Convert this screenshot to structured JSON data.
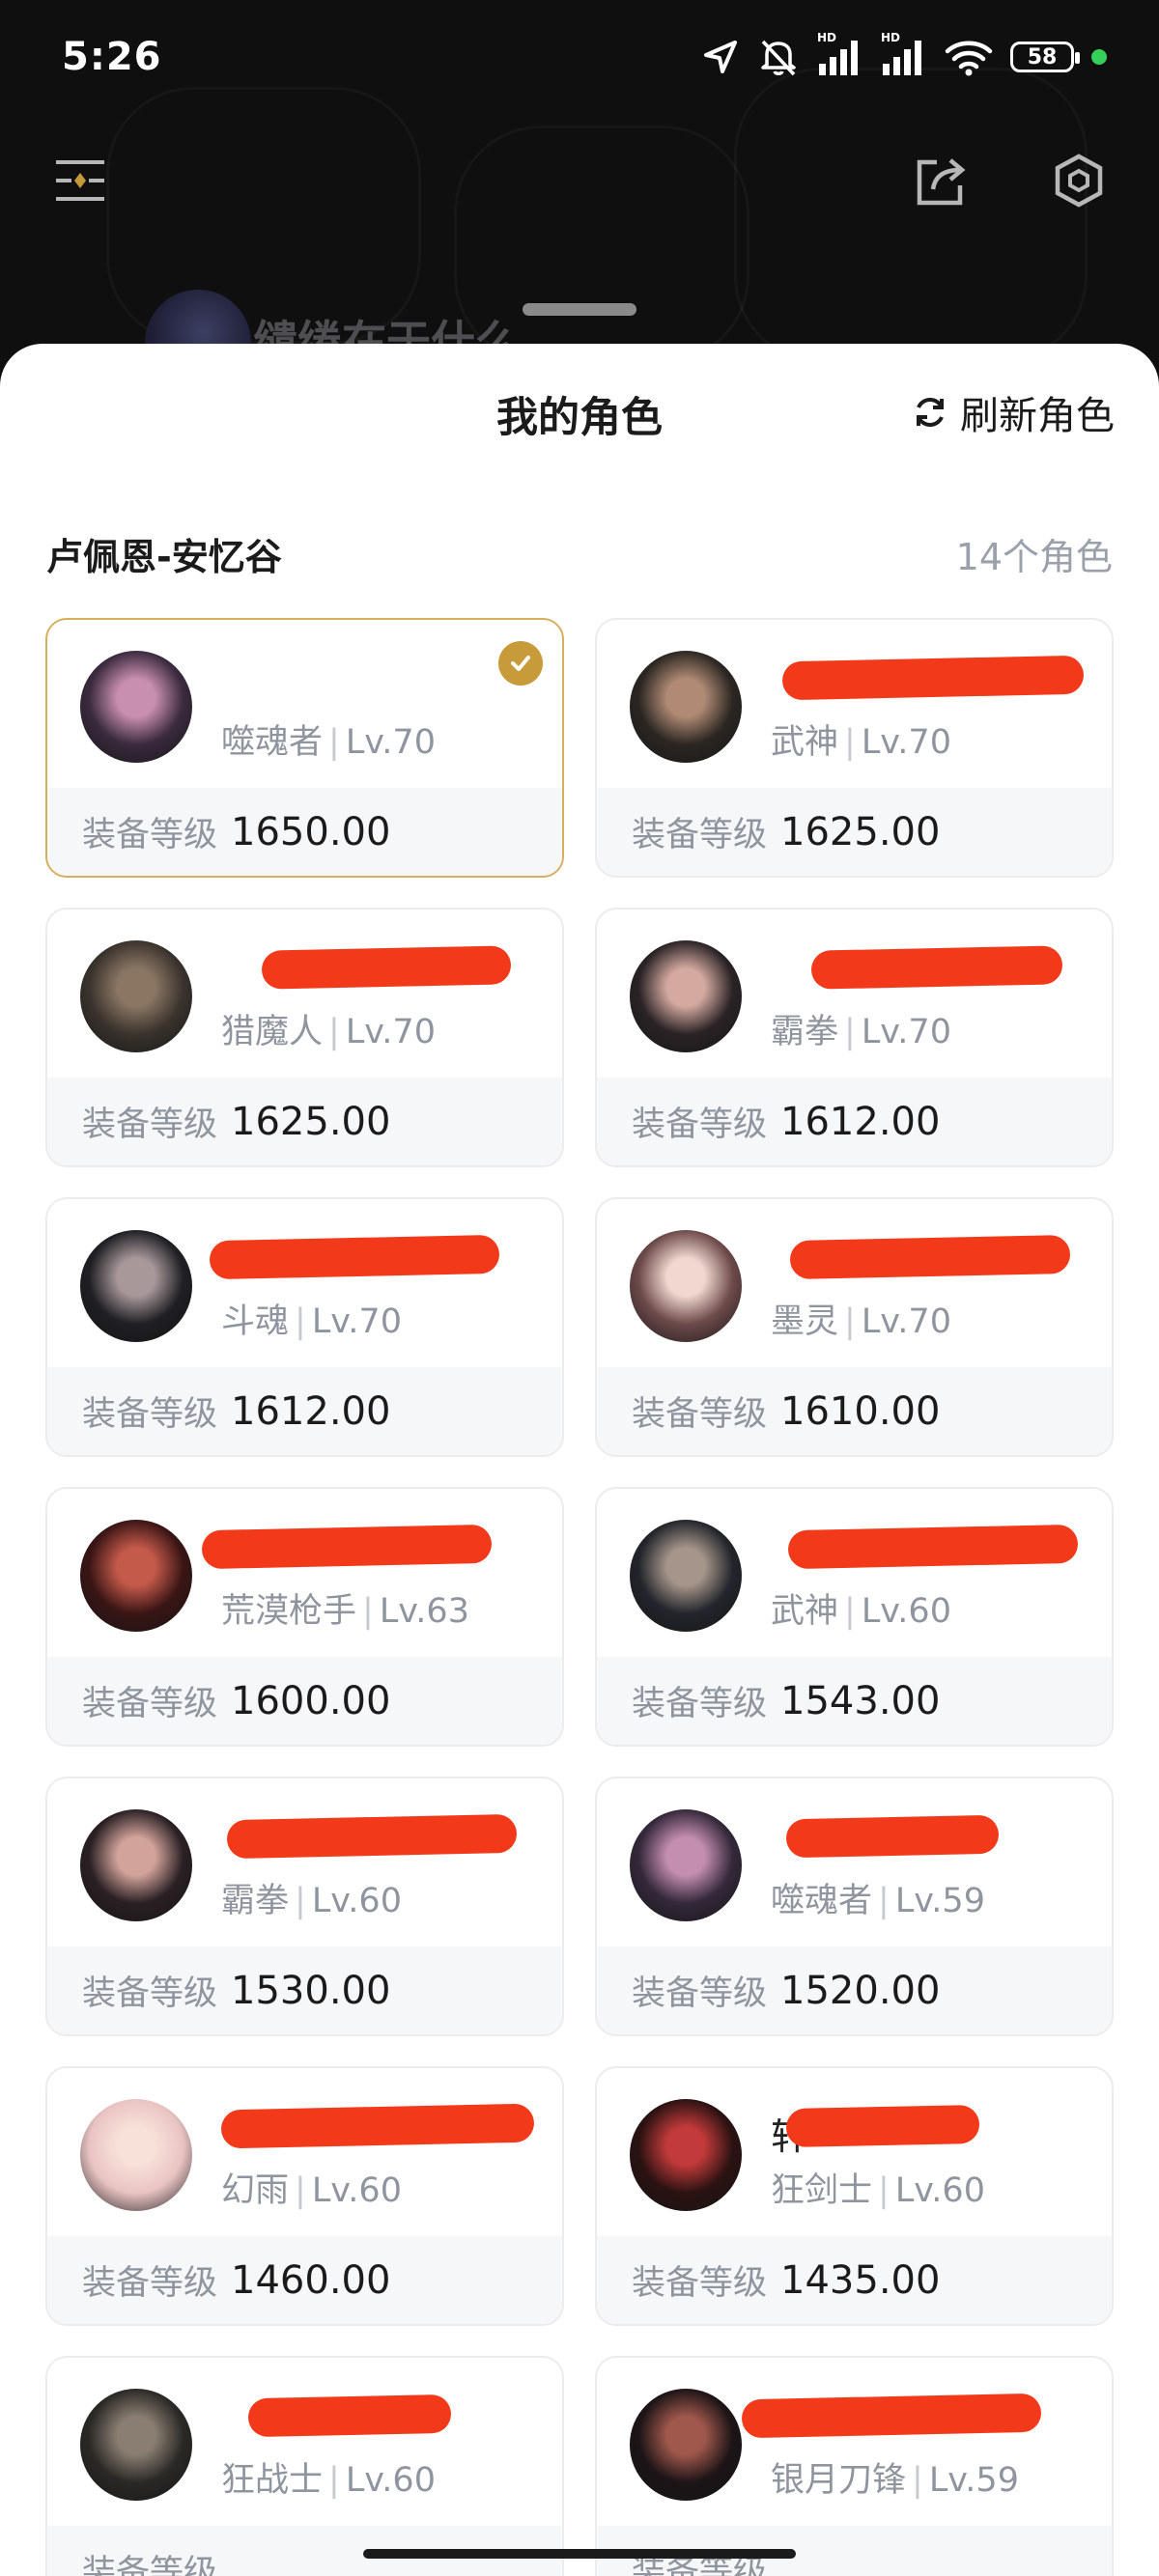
{
  "status_bar": {
    "time": "5:26",
    "hd1": "HD",
    "hd2": "HD",
    "battery": "58"
  },
  "background_app": {
    "profile_name": "缱绻在于什么"
  },
  "sheet": {
    "title": "我的角色",
    "refresh_label": "刷新角色",
    "server_name": "卢佩恩-安忆谷",
    "character_count": "14个角色",
    "gear_label": "装备等级"
  },
  "characters": [
    {
      "name": "",
      "class": "噬魂者",
      "level": "Lv.70",
      "gear": "1650.00",
      "selected": true,
      "avatar_bg": "#3a2a3e",
      "avatar_fg": "#c98fb0"
    },
    {
      "name": "",
      "class": "武神",
      "level": "Lv.70",
      "gear": "1625.00",
      "selected": false,
      "avatar_bg": "#2b2622",
      "avatar_fg": "#b08a74"
    },
    {
      "name": "",
      "class": "猎魔人",
      "level": "Lv.70",
      "gear": "1625.00",
      "selected": false,
      "avatar_bg": "#3a332d",
      "avatar_fg": "#8a7663"
    },
    {
      "name": "",
      "class": "霸拳",
      "level": "Lv.70",
      "gear": "1612.00",
      "selected": false,
      "avatar_bg": "#2a2325",
      "avatar_fg": "#d4a9a0"
    },
    {
      "name": "",
      "class": "斗魂",
      "level": "Lv.70",
      "gear": "1612.00",
      "selected": false,
      "avatar_bg": "#1f1f24",
      "avatar_fg": "#a8989a"
    },
    {
      "name": "",
      "class": "墨灵",
      "level": "Lv.70",
      "gear": "1610.00",
      "selected": false,
      "avatar_bg": "#6d4a4a",
      "avatar_fg": "#f0d7cf"
    },
    {
      "name": "",
      "class": "荒漠枪手",
      "level": "Lv.63",
      "gear": "1600.00",
      "selected": false,
      "avatar_bg": "#3a1515",
      "avatar_fg": "#c45a4a"
    },
    {
      "name": "",
      "class": "武神",
      "level": "Lv.60",
      "gear": "1543.00",
      "selected": false,
      "avatar_bg": "#22252b",
      "avatar_fg": "#a6958a"
    },
    {
      "name": "",
      "class": "霸拳",
      "level": "Lv.60",
      "gear": "1530.00",
      "selected": false,
      "avatar_bg": "#2a2024",
      "avatar_fg": "#d2a39a"
    },
    {
      "name": "",
      "class": "噬魂者",
      "level": "Lv.59",
      "gear": "1520.00",
      "selected": false,
      "avatar_bg": "#34283a",
      "avatar_fg": "#c48eb0"
    },
    {
      "name": "",
      "class": "幻雨",
      "level": "Lv.60",
      "gear": "1460.00",
      "selected": false,
      "avatar_bg": "#e9c3c3",
      "avatar_fg": "#f7e1d8"
    },
    {
      "name": "轩",
      "class": "狂剑士",
      "level": "Lv.60",
      "gear": "1435.00",
      "selected": false,
      "avatar_bg": "#2b1212",
      "avatar_fg": "#c23a3a"
    },
    {
      "name": "",
      "class": "狂战士",
      "level": "Lv.60",
      "gear": "",
      "selected": false,
      "avatar_bg": "#2b2926",
      "avatar_fg": "#8a7e72"
    },
    {
      "name": "",
      "class": "银月刀锋",
      "level": "Lv.59",
      "gear": "",
      "selected": false,
      "avatar_bg": "#1c1416",
      "avatar_fg": "#a0584c"
    }
  ],
  "colors": {
    "selected_border": "#d7ae5e",
    "check_badge": "#c79a3a",
    "redaction": "#f23a1b",
    "muted_text": "#8f959e"
  }
}
